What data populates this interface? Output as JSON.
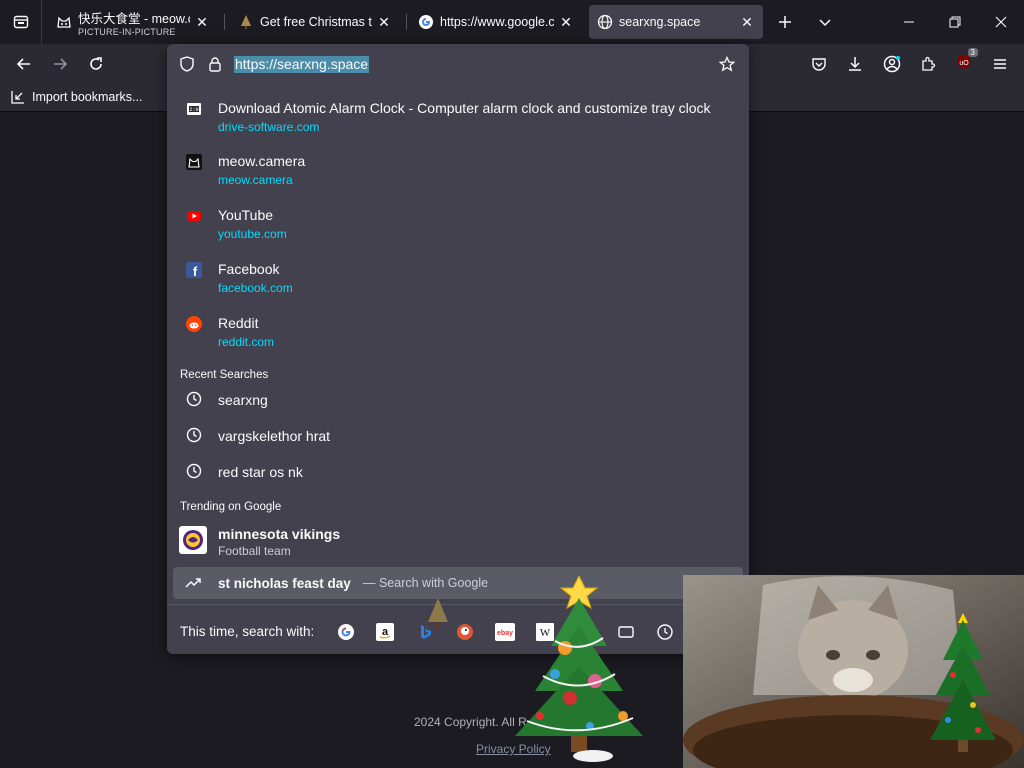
{
  "tabs": [
    {
      "title": "快乐大食堂 - meow.camera",
      "subtitle": "PICTURE-IN-PICTURE",
      "favicon": "cat-icon"
    },
    {
      "title": "Get free Christmas tree",
      "favicon": "tree-icon"
    },
    {
      "title": "https://www.google.com",
      "favicon": "google-icon"
    },
    {
      "title": "searxng.space",
      "favicon": "globe-icon",
      "active": true
    }
  ],
  "url": "https://searxng.space",
  "bookmarks": {
    "import_label": "Import bookmarks..."
  },
  "toolbar": {
    "extensions_badge": "3"
  },
  "suggestions": [
    {
      "title": "Download Atomic Alarm Clock - Computer alarm clock and customize tray clock",
      "url": "drive-software.com",
      "icon": "clock-app-icon"
    },
    {
      "title": "meow.camera",
      "url": "meow.camera",
      "icon": "cat-icon"
    },
    {
      "title": "YouTube",
      "url": "youtube.com",
      "icon": "youtube-icon"
    },
    {
      "title": "Facebook",
      "url": "facebook.com",
      "icon": "facebook-icon"
    },
    {
      "title": "Reddit",
      "url": "reddit.com",
      "icon": "reddit-icon"
    }
  ],
  "recent": {
    "label": "Recent Searches",
    "items": [
      "searxng",
      "vargskelethor hrat",
      "red star os nk"
    ]
  },
  "trending": {
    "label": "Trending on Google",
    "title": "minnesota vikings",
    "subtitle": "Football team"
  },
  "selected": {
    "query": "st nicholas feast day",
    "action": "— Search with Google"
  },
  "oneoff": {
    "label": "This time, search with:",
    "engines": [
      "google-icon",
      "amazon-icon",
      "bing-icon",
      "duckduckgo-icon",
      "ebay-icon",
      "wikipedia-icon",
      "tabs-icon",
      "history-icon"
    ]
  },
  "page": {
    "copyright": "2024 Copyright. All R",
    "privacy": "Privacy Policy"
  }
}
